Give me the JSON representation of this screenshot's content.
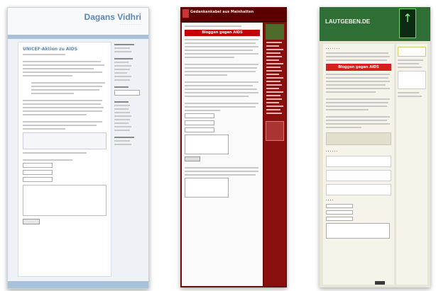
{
  "shot1": {
    "blog_title": "Dagans Vidhri",
    "post_title": "UNICEF-Aktion zu AIDS"
  },
  "shot2": {
    "blog_title": "Gedankenkabel aus Mainhatten",
    "banner": "Bloggen gegen AIDS"
  },
  "shot3": {
    "blog_title": "LAUTGEBEN.DE",
    "banner": "Bloggen gegen AIDS"
  }
}
